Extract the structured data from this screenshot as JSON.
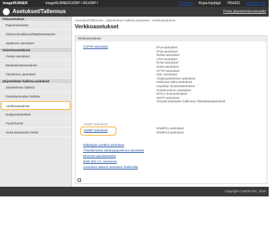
{
  "topbar": {
    "brand": "imageRUNNER",
    "model": "imageRUNNER1435P / iR1435P /",
    "links": [
      "Portaaliin",
      "Kirjaa käyttäjä:",
      "7654321",
      "Kirjaudu ulos"
    ]
  },
  "titlebar": {
    "title": "Asetukset/Tallennus",
    "portal": "Posta järjestelmänvalvojalle"
  },
  "sidebar": {
    "sections": [
      {
        "heading": "Yleisasetukset",
        "items": [
          "Paperiasetukset",
          "Äänenvoimakkuus/Näyttöasetukset",
          "Ajastimen asetukset"
        ]
      },
      {
        "heading": "Toimintoasetukset",
        "items": [
          "Yleiset asetukset",
          "Mediatulosteasetukset",
          "Tulostimen asetukset"
        ]
      },
      {
        "heading": "Järjestelmän hallinta-asetukset",
        "items": [
          "Järjestelmän hallinta",
          "Osoitetunnusten hallinta",
          "Verkkoasetukset",
          "Suojausasetukset",
          "Tuonti/Vienti",
          "Alustusasetusten tiedot"
        ]
      }
    ],
    "active_item": "Verkkoasetukset"
  },
  "main": {
    "breadcrumb": "Asetukset/Tallennus : Järjestelmän hallinta-asetukset : Verkkoasetukset",
    "title": "Verkkoasetukset",
    "section_heading": "Verkkoasetukset",
    "tcp_link": "TCP/IP-asetukset",
    "tcp_items": [
      "IPv4-asetukset",
      "IPv6-asetukset",
      "WINS-asetukset",
      "LPD-asetukset",
      "RAW-asetukset",
      "WSD-asetukset",
      "HTTP-asetukset",
      "SSL-asetukset",
      "Välityspalvelimen asetukset",
      "Multicast Haku-asetukset",
      "Lepotilan ilmoitusasetukset",
      "Porttinumeron asetukset",
      "MTU:n kokoasetukset",
      "SNTP-asetukset",
      "Osoiteluetteloiden hallinnan Pitkäaikaisasetukset"
    ],
    "snmp_ghost": "SNMP-asetukset",
    "snmp_link": "SNMP-asetukset",
    "snmp_items": [
      "SNMPv1-asetukset",
      "SNMPv3-asetukset"
    ],
    "links": [
      "Näkettyjen porttien asetukset",
      "Yhteistiimissin ädoituspalvelimen asetukset",
      "Ethernet-ajuriasetukset",
      "IEEE 802.1X -asetukset",
      "Asetukset laitteen asetusten hallinnalle"
    ]
  },
  "footer": {
    "copyright": "Copyright CANON INC. 2015"
  },
  "colors": {
    "highlight": "#f5a623",
    "link": "#1a4fa0",
    "header_bg": "#3a3a3a"
  }
}
